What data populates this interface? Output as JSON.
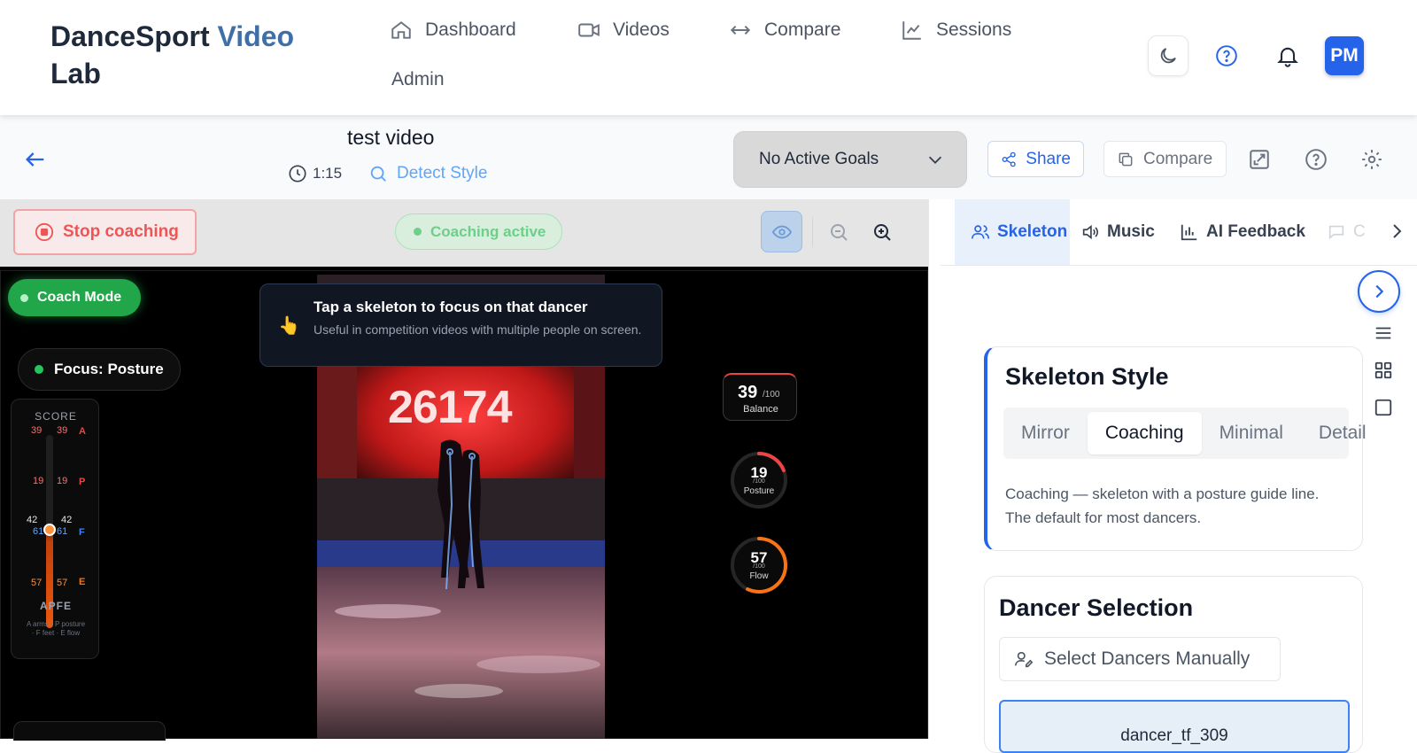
{
  "app": {
    "title_main": "DanceSport",
    "title_accent": "Video",
    "title_line2": "Lab"
  },
  "nav": {
    "items": [
      {
        "label": "Dashboard",
        "icon": "home-icon"
      },
      {
        "label": "Videos",
        "icon": "video-camera-icon"
      },
      {
        "label": "Compare",
        "icon": "arrows-horizontal-icon"
      },
      {
        "label": "Sessions",
        "icon": "trend-chart-icon"
      },
      {
        "label": "Admin",
        "icon": ""
      }
    ]
  },
  "user": {
    "initials": "PM"
  },
  "video": {
    "title": "test video",
    "duration": "1:15",
    "detect_style": "Detect Style"
  },
  "goals": {
    "selected": "No Active Goals"
  },
  "toolbar": {
    "share": "Share",
    "compare": "Compare"
  },
  "coaching": {
    "stop_label": "Stop coaching",
    "status_label": "Coaching active",
    "mode_label": "Coach Mode",
    "focus_label": "Focus: Posture"
  },
  "tooltip": {
    "icon": "👆",
    "title": "Tap a skeleton to focus on that dancer",
    "body": "Useful in competition videos with multiple people on screen."
  },
  "score": {
    "heading": "SCORE",
    "rows": [
      {
        "left": "39",
        "right": "39",
        "letter": "A"
      },
      {
        "left": "19",
        "right": "19",
        "letter": "P"
      },
      {
        "left": "42",
        "right": "42",
        "letter": ""
      },
      {
        "left": "61",
        "right": "61",
        "letter": "F"
      },
      {
        "left": "57",
        "right": "57",
        "letter": "E"
      }
    ],
    "footer": "APFE",
    "legend_line1": "A arms · P posture",
    "legend_line2": "· F feet · E flow"
  },
  "scoreboard_text": "26174",
  "metrics": [
    {
      "value": "39",
      "max": "/100",
      "label": "Balance",
      "fraction": 0.39
    },
    {
      "value": "19",
      "max": "/100",
      "label": "Posture",
      "fraction": 0.19
    },
    {
      "value": "57",
      "max": "/100",
      "label": "Flow",
      "fraction": 0.57
    }
  ],
  "panel": {
    "tabs": [
      {
        "label": "Skeleton",
        "icon": "users-icon",
        "active": true
      },
      {
        "label": "Music",
        "icon": "speaker-icon",
        "active": false
      },
      {
        "label": "AI Feedback",
        "icon": "bar-chart-icon",
        "active": false
      },
      {
        "label": "C",
        "icon": "chat-icon",
        "active": false
      }
    ],
    "skeleton_style": {
      "title": "Skeleton Style",
      "options": [
        "Mirror",
        "Coaching",
        "Minimal",
        "Detail"
      ],
      "selected": "Coaching",
      "description": "Coaching — skeleton with a posture guide line. The default for most dancers."
    },
    "dancer_selection": {
      "title": "Dancer Selection",
      "button": "Select Dancers Manually",
      "dancer_label": "dancer_tf_309"
    }
  },
  "colors": {
    "accent": "#2563eb",
    "coach_green": "#22a64a",
    "stop_red": "#ef5555",
    "posture_red": "#ef4444",
    "flow_orange": "#f97316"
  }
}
